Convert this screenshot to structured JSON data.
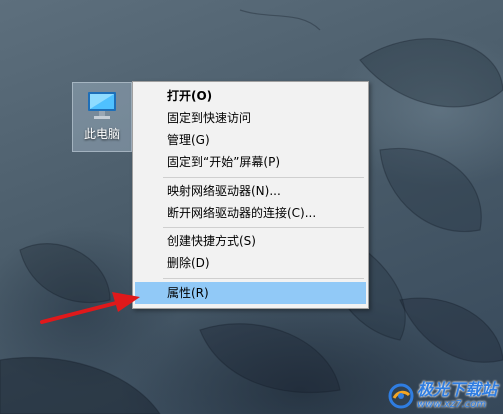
{
  "desktop": {
    "icon_label": "此电脑"
  },
  "context_menu": {
    "items": [
      {
        "label": "打开(O)"
      },
      {
        "label": "固定到快速访问"
      },
      {
        "label": "管理(G)"
      },
      {
        "label": "固定到“开始”屏幕(P)"
      },
      {
        "label": "映射网络驱动器(N)..."
      },
      {
        "label": "断开网络驱动器的连接(C)..."
      },
      {
        "label": "创建快捷方式(S)"
      },
      {
        "label": "删除(D)"
      },
      {
        "label": "属性(R)"
      }
    ],
    "highlighted_item": "属性(R)",
    "highlight_color": "#91c9f7"
  },
  "annotation": {
    "arrow_color": "#e0191b"
  },
  "watermark": {
    "name": "极光下载站",
    "url": "www.xz7.com"
  }
}
